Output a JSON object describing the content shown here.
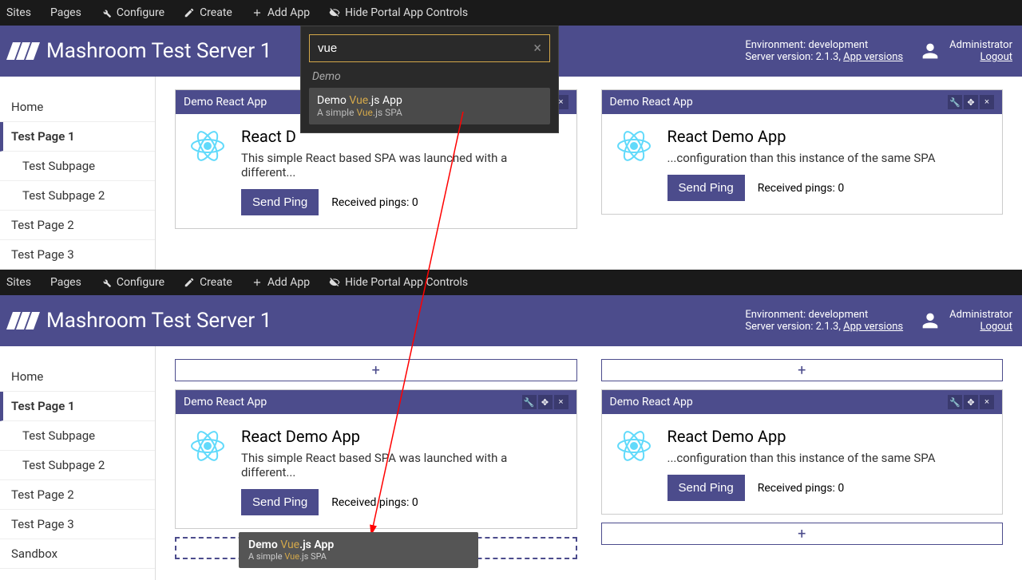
{
  "topbar": {
    "sites": "Sites",
    "pages": "Pages",
    "configure": "Configure",
    "create": "Create",
    "add_app": "Add App",
    "hide_controls": "Hide Portal App Controls"
  },
  "header": {
    "title": "Mashroom Test Server 1",
    "env_label": "Environment: development",
    "version_label": "Server version: 2.1.3, ",
    "versions_link": "App versions",
    "user_name": "Administrator",
    "logout": "Logout"
  },
  "sidebar_top": {
    "items": [
      {
        "label": "Home",
        "active": false,
        "sub": false
      },
      {
        "label": "Test Page 1",
        "active": true,
        "sub": false
      },
      {
        "label": "Test Subpage",
        "active": false,
        "sub": true
      },
      {
        "label": "Test Subpage 2",
        "active": false,
        "sub": true
      },
      {
        "label": "Test Page 2",
        "active": false,
        "sub": false
      },
      {
        "label": "Test Page 3",
        "active": false,
        "sub": false
      }
    ]
  },
  "sidebar_bottom": {
    "items": [
      {
        "label": "Home",
        "active": false,
        "sub": false
      },
      {
        "label": "Test Page 1",
        "active": true,
        "sub": false
      },
      {
        "label": "Test Subpage",
        "active": false,
        "sub": true
      },
      {
        "label": "Test Subpage 2",
        "active": false,
        "sub": true
      },
      {
        "label": "Test Page 2",
        "active": false,
        "sub": false
      },
      {
        "label": "Test Page 3",
        "active": false,
        "sub": false
      },
      {
        "label": "Sandbox",
        "active": false,
        "sub": false
      }
    ]
  },
  "cards": {
    "left": {
      "header": "Demo React App",
      "title": "React Demo App",
      "desc": "This simple React based SPA was launched with a different...",
      "btn": "Send Ping",
      "pings": "Received pings: 0"
    },
    "left_top_desc": "This simple React based SPA was launched with a different...",
    "left_top_title_truncated": "React D",
    "right": {
      "header": "Demo React App",
      "title": "React Demo App",
      "desc": "...configuration than this instance of the same SPA",
      "btn": "Send Ping",
      "pings": "Received pings: 0"
    }
  },
  "search": {
    "value": "vue",
    "category": "Demo",
    "result_title_pre": "Demo ",
    "result_title_hl": "Vue",
    "result_title_post": ".js App",
    "result_desc_pre": "A simple ",
    "result_desc_hl": "Vue",
    "result_desc_post": ".js SPA"
  },
  "plus": "+"
}
